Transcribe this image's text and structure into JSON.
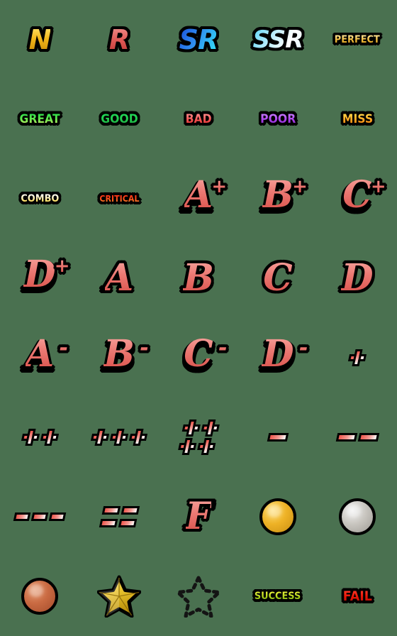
{
  "sheet": {
    "title": "Rank and Grade Emoji Sheet",
    "background_color": "#4a7150",
    "columns": 5,
    "rows": 8,
    "cell_size": 112
  },
  "items": [
    {
      "id": "rank-n",
      "label": "N",
      "kind": "rarity-letter",
      "style": "gold",
      "row": 1,
      "col": 1
    },
    {
      "id": "rank-r",
      "label": "R",
      "kind": "rarity-letter",
      "style": "red",
      "row": 1,
      "col": 2
    },
    {
      "id": "rank-sr",
      "label": "SR",
      "kind": "rarity-letter",
      "style": "blue",
      "row": 1,
      "col": 3
    },
    {
      "id": "rank-ssr",
      "label": "SSR",
      "kind": "rarity-letter",
      "style": "cyan",
      "row": 1,
      "col": 4
    },
    {
      "id": "judge-perfect",
      "label": "PERFECT",
      "kind": "word",
      "style": "gold",
      "row": 1,
      "col": 5
    },
    {
      "id": "judge-great",
      "label": "GREAT",
      "kind": "word",
      "style": "green-yellow",
      "row": 2,
      "col": 1
    },
    {
      "id": "judge-good",
      "label": "GOOD",
      "kind": "word",
      "style": "green",
      "row": 2,
      "col": 2
    },
    {
      "id": "judge-bad",
      "label": "BAD",
      "kind": "word",
      "style": "red",
      "row": 2,
      "col": 3
    },
    {
      "id": "judge-poor",
      "label": "POOR",
      "kind": "word",
      "style": "purple",
      "row": 2,
      "col": 4
    },
    {
      "id": "judge-miss",
      "label": "MISS",
      "kind": "word",
      "style": "orange",
      "row": 2,
      "col": 5
    },
    {
      "id": "judge-combo",
      "label": "COMBO",
      "kind": "word",
      "style": "white-yellow",
      "row": 3,
      "col": 1
    },
    {
      "id": "judge-critical",
      "label": "CRITICAL",
      "kind": "word",
      "style": "red-orange",
      "row": 3,
      "col": 2
    },
    {
      "id": "grade-a-plus",
      "label": "A",
      "sign": "+",
      "kind": "grade",
      "row": 3,
      "col": 3
    },
    {
      "id": "grade-b-plus",
      "label": "B",
      "sign": "+",
      "kind": "grade",
      "row": 3,
      "col": 4
    },
    {
      "id": "grade-c-plus",
      "label": "C",
      "sign": "+",
      "kind": "grade",
      "row": 3,
      "col": 5
    },
    {
      "id": "grade-d-plus",
      "label": "D",
      "sign": "+",
      "kind": "grade",
      "row": 4,
      "col": 1
    },
    {
      "id": "grade-a",
      "label": "A",
      "sign": "",
      "kind": "grade",
      "row": 4,
      "col": 2
    },
    {
      "id": "grade-b",
      "label": "B",
      "sign": "",
      "kind": "grade",
      "row": 4,
      "col": 3
    },
    {
      "id": "grade-c",
      "label": "C",
      "sign": "",
      "kind": "grade",
      "row": 4,
      "col": 4
    },
    {
      "id": "grade-d",
      "label": "D",
      "sign": "",
      "kind": "grade",
      "row": 4,
      "col": 5
    },
    {
      "id": "grade-a-minus",
      "label": "A",
      "sign": "-",
      "kind": "grade",
      "row": 5,
      "col": 1
    },
    {
      "id": "grade-b-minus",
      "label": "B",
      "sign": "-",
      "kind": "grade",
      "row": 5,
      "col": 2
    },
    {
      "id": "grade-c-minus",
      "label": "C",
      "sign": "-",
      "kind": "grade",
      "row": 5,
      "col": 3
    },
    {
      "id": "grade-d-minus",
      "label": "D",
      "sign": "-",
      "kind": "grade",
      "row": 5,
      "col": 4
    },
    {
      "id": "mark-plus-1",
      "label": "+",
      "kind": "marks",
      "plus_count": 1,
      "layout": "single",
      "row": 5,
      "col": 5
    },
    {
      "id": "mark-plus-2",
      "label": "++",
      "kind": "marks",
      "plus_count": 2,
      "layout": "row",
      "row": 6,
      "col": 1
    },
    {
      "id": "mark-plus-3",
      "label": "+++",
      "kind": "marks",
      "plus_count": 3,
      "layout": "row",
      "row": 6,
      "col": 2
    },
    {
      "id": "mark-plus-4",
      "label": "++++",
      "kind": "marks",
      "plus_count": 4,
      "layout": "grid",
      "row": 6,
      "col": 3
    },
    {
      "id": "mark-minus-1",
      "label": "-",
      "kind": "marks",
      "dash_count": 1,
      "layout": "row",
      "row": 6,
      "col": 4
    },
    {
      "id": "mark-minus-2",
      "label": "--",
      "kind": "marks",
      "dash_count": 2,
      "layout": "row",
      "row": 6,
      "col": 5
    },
    {
      "id": "mark-minus-3",
      "label": "---",
      "kind": "marks",
      "dash_count": 3,
      "layout": "row",
      "row": 7,
      "col": 1
    },
    {
      "id": "mark-minus-4",
      "label": "====",
      "kind": "marks",
      "dash_count": 4,
      "layout": "grid",
      "row": 7,
      "col": 2
    },
    {
      "id": "grade-f",
      "label": "F",
      "sign": "",
      "kind": "grade",
      "row": 7,
      "col": 3
    },
    {
      "id": "medal-gold",
      "label": "Gold Medal",
      "kind": "medal",
      "style": "gold",
      "row": 7,
      "col": 4
    },
    {
      "id": "medal-silver",
      "label": "Silver Medal",
      "kind": "medal",
      "style": "silver",
      "row": 7,
      "col": 5
    },
    {
      "id": "medal-bronze",
      "label": "Bronze Medal",
      "kind": "medal",
      "style": "bronze",
      "row": 8,
      "col": 1
    },
    {
      "id": "star-filled",
      "label": "Gold Star",
      "kind": "star",
      "style": "filled",
      "row": 8,
      "col": 2
    },
    {
      "id": "star-outline",
      "label": "Empty Star",
      "kind": "star",
      "style": "dotted",
      "row": 8,
      "col": 3
    },
    {
      "id": "result-success",
      "label": "SUCCESS",
      "kind": "word",
      "style": "yellow-green",
      "row": 8,
      "col": 4
    },
    {
      "id": "result-fail",
      "label": "FAIL",
      "kind": "word",
      "style": "red",
      "row": 8,
      "col": 5
    }
  ],
  "colors": {
    "background": "#4a7150",
    "outline": "#000000",
    "gold": "#f3b81b",
    "rarity_red": "#e05a56",
    "sr_blue": "#2f8ef0",
    "ssr_cyan": "#5ed6f7",
    "grade_salmon": "#ec7b75",
    "great_green": "#63e84c",
    "good_green": "#23c94d",
    "bad_red": "#f4514f",
    "poor_purple": "#a93fe8",
    "miss_orange": "#ffa41f",
    "combo_yellow": "#ffd21e",
    "critical_orange": "#fb4a1a",
    "success_green": "#b7d61d",
    "fail_red": "#e81607",
    "medal_gold": "#eeb226",
    "medal_silver": "#c9c6c0",
    "medal_bronze": "#c96a42",
    "star_gold": "#e9c42e"
  }
}
